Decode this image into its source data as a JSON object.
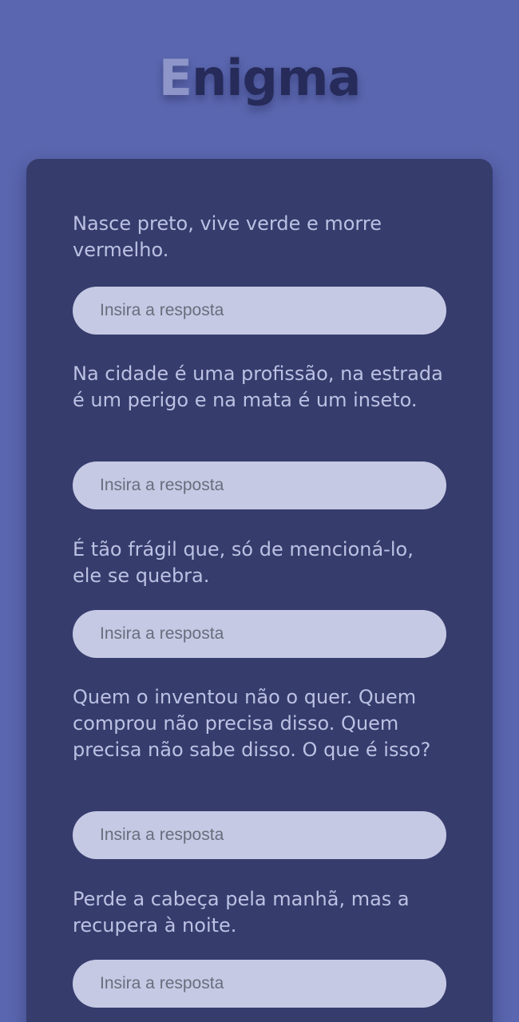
{
  "app": {
    "title_first": "E",
    "title_rest": "nigma"
  },
  "riddles": [
    {
      "question": "Nasce preto, vive verde e morre vermelho.",
      "placeholder": "Insira a resposta"
    },
    {
      "question": "Na cidade é uma profissão, na estrada é um perigo e na mata é um inseto.",
      "placeholder": "Insira a resposta"
    },
    {
      "question": "É tão frágil que, só de mencioná-lo, ele se quebra.",
      "placeholder": "Insira a resposta"
    },
    {
      "question": "Quem o inventou não o quer. Quem comprou não precisa disso. Quem precisa não sabe disso. O que é isso?",
      "placeholder": "Insira a resposta"
    },
    {
      "question": "Perde a cabeça pela manhã, mas a recupera à noite.",
      "placeholder": "Insira a resposta"
    }
  ],
  "colors": {
    "background": "#5a66af",
    "card": "#363c6c",
    "input": "#c5c9e4",
    "text": "#bcc1e3",
    "title": "#262b5a",
    "title_accent": "#8e95c8"
  }
}
